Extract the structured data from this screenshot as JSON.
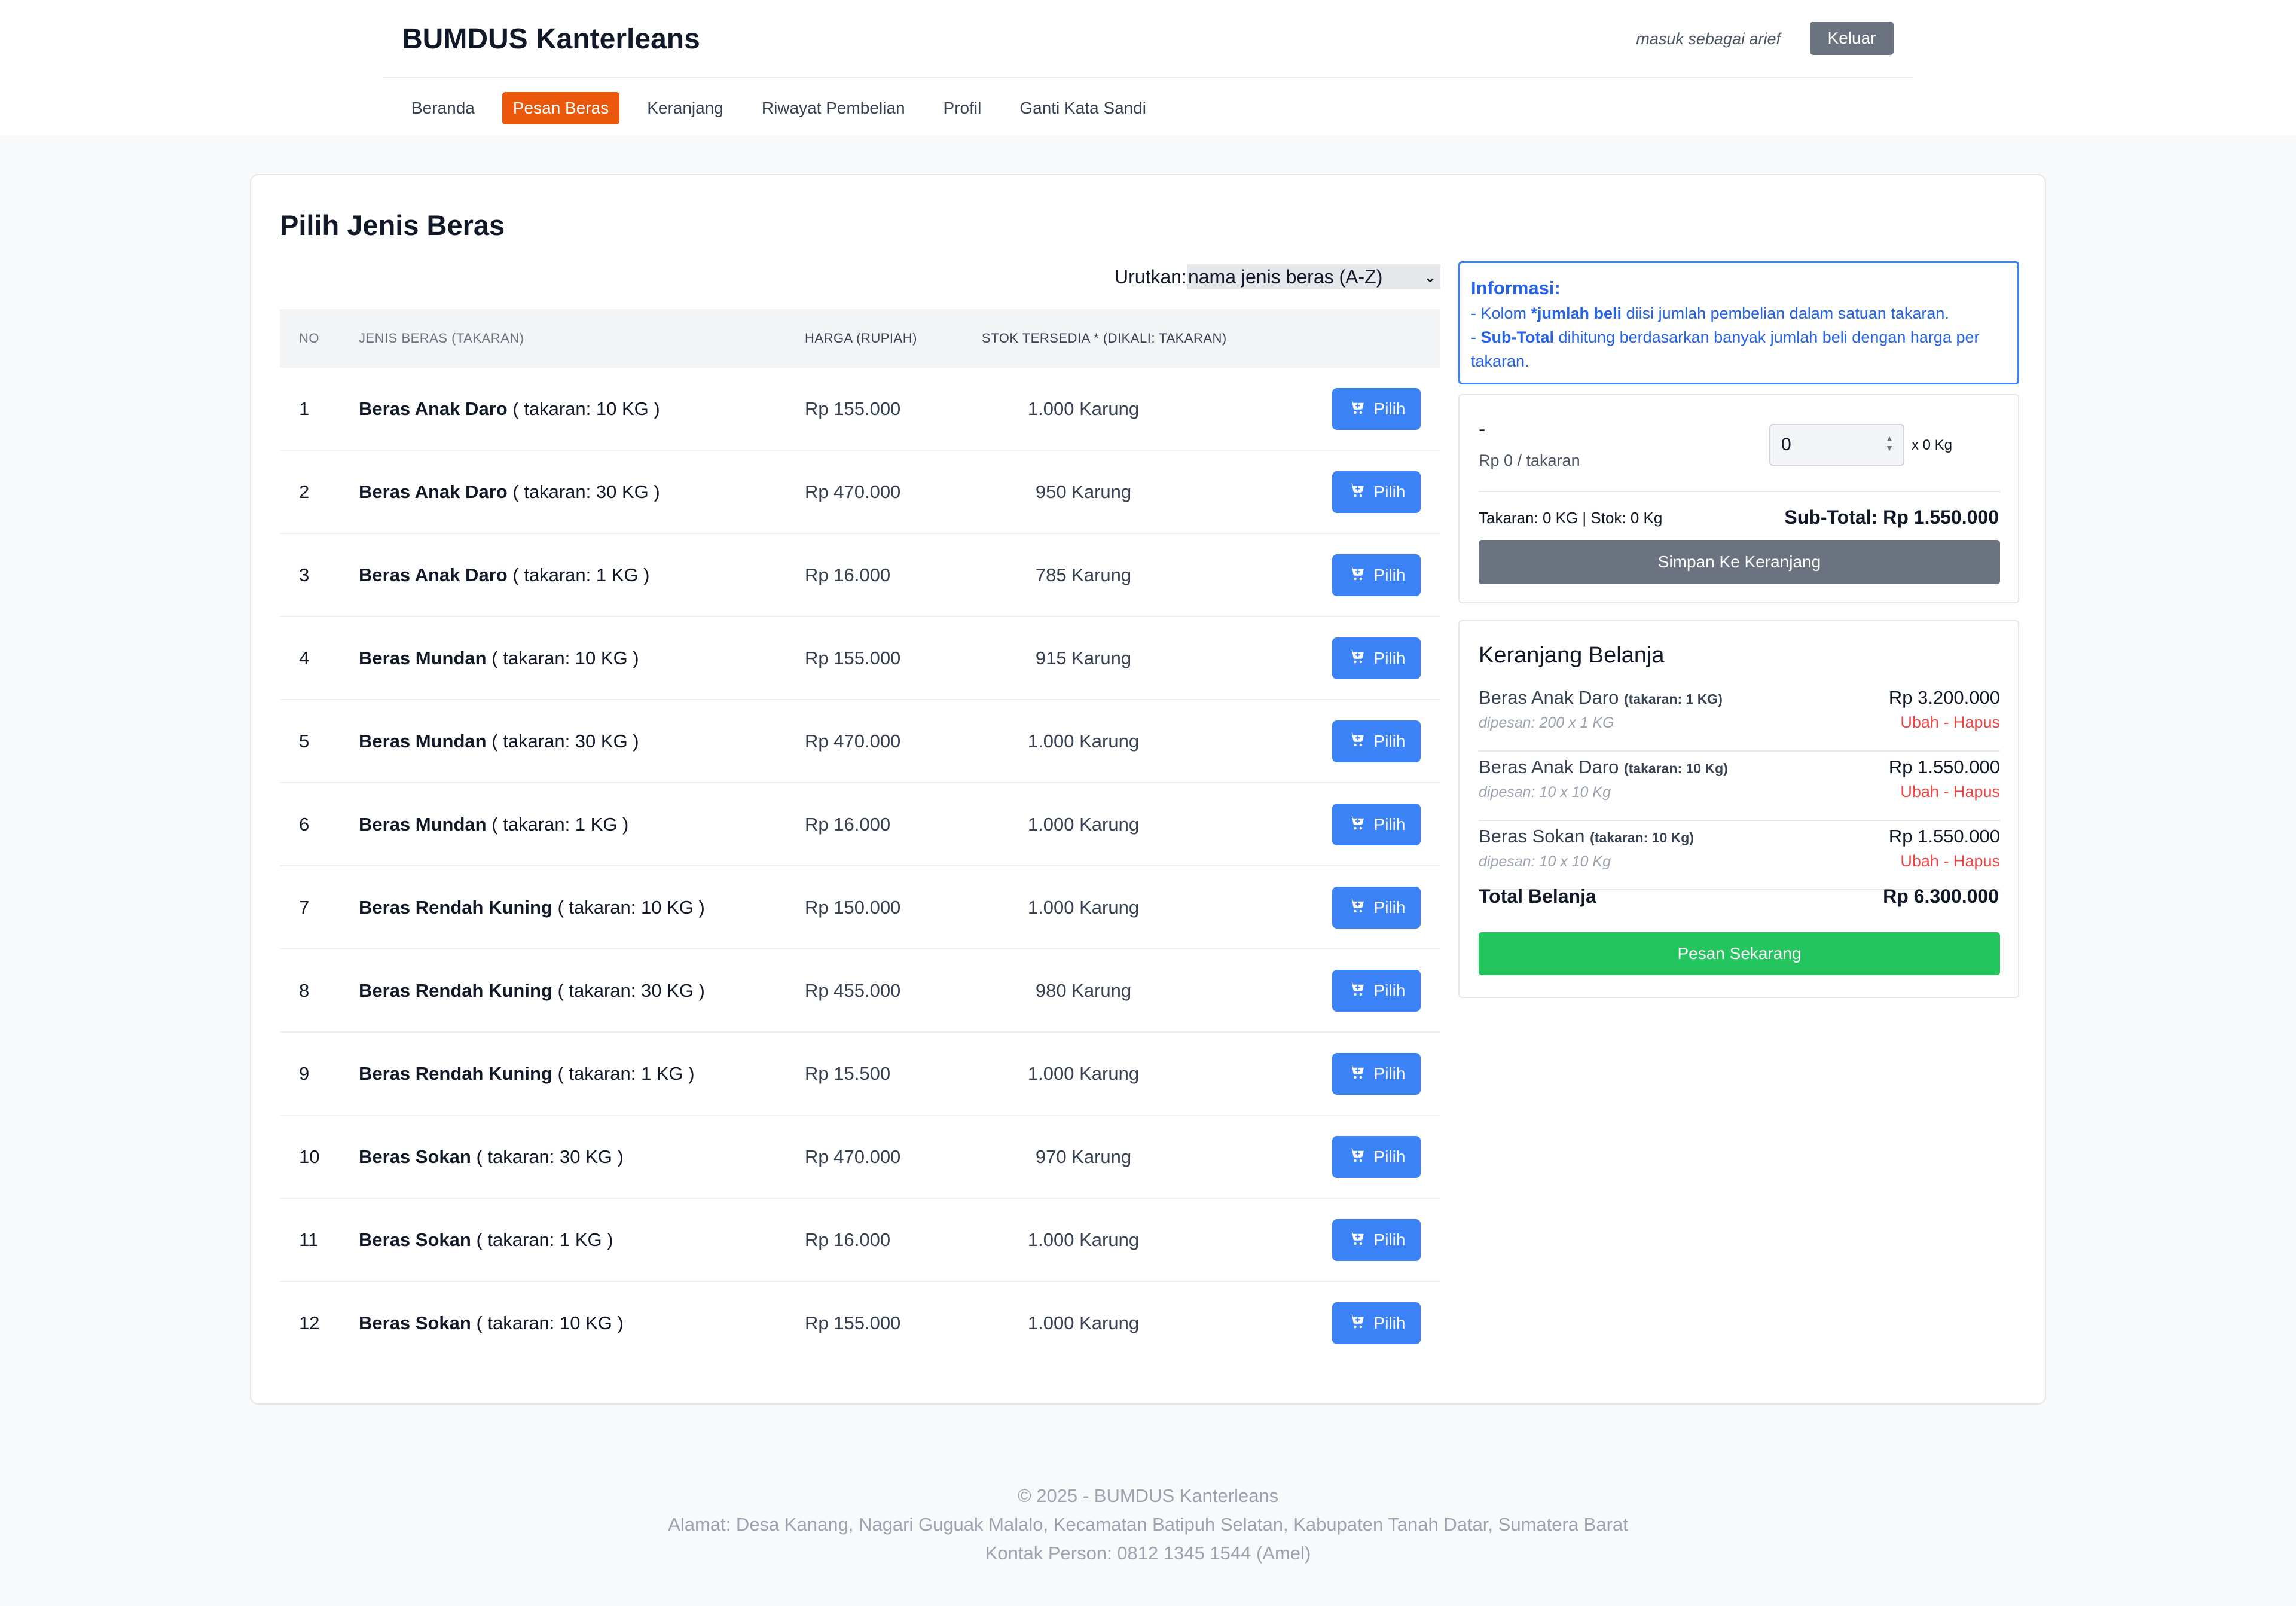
{
  "header": {
    "brand": "BUMDUS Kanterleans",
    "logged_in_as": "masuk sebagai arief",
    "logout_label": "Keluar",
    "nav": [
      {
        "label": "Beranda",
        "active": false
      },
      {
        "label": "Pesan Beras",
        "active": true
      },
      {
        "label": "Keranjang",
        "active": false
      },
      {
        "label": "Riwayat Pembelian",
        "active": false
      },
      {
        "label": "Profil",
        "active": false
      },
      {
        "label": "Ganti Kata Sandi",
        "active": false
      }
    ],
    "accent_color": "#ea580c"
  },
  "main": {
    "title": "Pilih Jenis Beras",
    "sort": {
      "label": "Urutkan:",
      "selected": "nama jenis beras (A-Z)"
    },
    "columns": {
      "no": "NO",
      "name": "JENIS BERAS (TAKARAN)",
      "price": "HARGA (RUPIAH)",
      "stock": "STOK TERSEDIA * (DIKALI: TAKARAN)"
    },
    "pick_label": "Pilih",
    "rows": [
      {
        "no": "1",
        "name": "Beras Anak Daro",
        "size": "( takaran: 10 KG )",
        "price": "Rp 155.000",
        "stock": "1.000 Karung"
      },
      {
        "no": "2",
        "name": "Beras Anak Daro",
        "size": "( takaran: 30 KG )",
        "price": "Rp 470.000",
        "stock": "950 Karung"
      },
      {
        "no": "3",
        "name": "Beras Anak Daro",
        "size": "( takaran: 1 KG )",
        "price": "Rp 16.000",
        "stock": "785 Karung"
      },
      {
        "no": "4",
        "name": "Beras Mundan",
        "size": "( takaran: 10 KG )",
        "price": "Rp 155.000",
        "stock": "915 Karung"
      },
      {
        "no": "5",
        "name": "Beras Mundan",
        "size": "( takaran: 30 KG )",
        "price": "Rp 470.000",
        "stock": "1.000 Karung"
      },
      {
        "no": "6",
        "name": "Beras Mundan",
        "size": "( takaran: 1 KG )",
        "price": "Rp 16.000",
        "stock": "1.000 Karung"
      },
      {
        "no": "7",
        "name": "Beras Rendah Kuning",
        "size": "( takaran: 10 KG )",
        "price": "Rp 150.000",
        "stock": "1.000 Karung"
      },
      {
        "no": "8",
        "name": "Beras Rendah Kuning",
        "size": "( takaran: 30 KG )",
        "price": "Rp 455.000",
        "stock": "980 Karung"
      },
      {
        "no": "9",
        "name": "Beras Rendah Kuning",
        "size": "( takaran: 1 KG )",
        "price": "Rp 15.500",
        "stock": "1.000 Karung"
      },
      {
        "no": "10",
        "name": "Beras Sokan",
        "size": "( takaran: 30 KG )",
        "price": "Rp 470.000",
        "stock": "970 Karung"
      },
      {
        "no": "11",
        "name": "Beras Sokan",
        "size": "( takaran: 1 KG )",
        "price": "Rp 16.000",
        "stock": "1.000 Karung"
      },
      {
        "no": "12",
        "name": "Beras Sokan",
        "size": "( takaran: 10 KG )",
        "price": "Rp 155.000",
        "stock": "1.000 Karung"
      }
    ]
  },
  "info": {
    "title": "Informasi:",
    "line1_pre": "- Kolom ",
    "line1_bold": "*jumlah beli",
    "line1_post": " diisi jumlah pembelian dalam satuan takaran.",
    "line2_pre": "- ",
    "line2_bold": "Sub-Total",
    "line2_post": " dihitung berdasarkan banyak jumlah beli dengan harga per takaran.",
    "color": "#2563eb"
  },
  "order": {
    "product": "-",
    "unit_price": "Rp 0 / takaran",
    "qty": "0",
    "qty_suffix": "x 0 Kg",
    "stock_info": "Takaran: 0 KG | Stok: 0 Kg",
    "subtotal": "Sub-Total: Rp 1.550.000",
    "save_label": "Simpan Ke Keranjang"
  },
  "cart": {
    "title": "Keranjang Belanja",
    "items": [
      {
        "name": "Beras Anak Daro",
        "size": "(takaran: 1 KG)",
        "price": "Rp 3.200.000",
        "desc": "dipesan: 200 x 1 KG",
        "actions": "Ubah - Hapus"
      },
      {
        "name": "Beras Anak Daro",
        "size": "(takaran: 10 Kg)",
        "price": "Rp 1.550.000",
        "desc": "dipesan: 10 x 10 Kg",
        "actions": "Ubah - Hapus"
      },
      {
        "name": "Beras Sokan",
        "size": "(takaran: 10 Kg)",
        "price": "Rp 1.550.000",
        "desc": "dipesan: 10 x 10 Kg",
        "actions": "Ubah - Hapus"
      }
    ],
    "total_label": "Total Belanja",
    "total_value": "Rp 6.300.000",
    "order_label": "Pesan Sekarang",
    "order_color": "#22c55e"
  },
  "footer": {
    "copyright": "© 2025 - BUMDUS Kanterleans",
    "address": "Alamat: Desa Kanang, Nagari Guguak Malalo, Kecamatan Batipuh Selatan, Kabupaten Tanah Datar, Sumatera Barat",
    "contact": "Kontak Person: 0812 1345 1544 (Amel)"
  }
}
